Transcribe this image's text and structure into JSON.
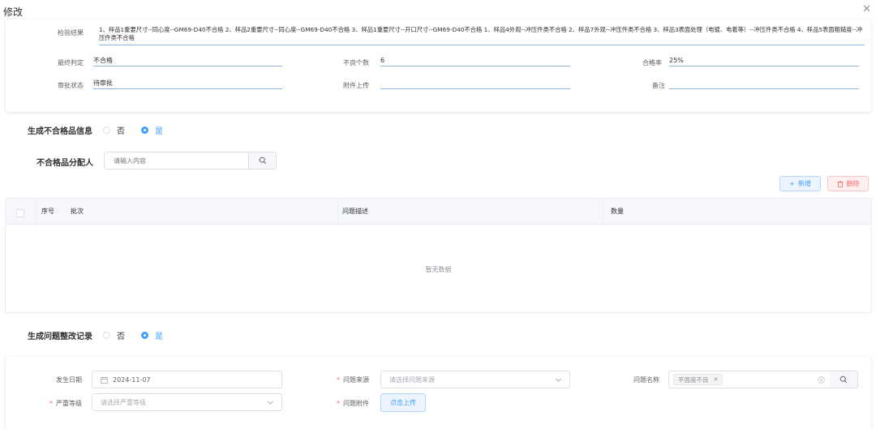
{
  "dialog": {
    "title": "修改"
  },
  "info": {
    "result_label": "检验结果",
    "result_text": "1、样品1重要尺寸--同心度--GM69-D40不合格 2、样品2重要尺寸--同心度--GM69-D40不合格 3、样品1重要尺寸--开口尺寸--GM69-D40不合格 1、样品4外观--冲压件类不合格 2、样品7外观--冲压件类不合格 3、样品3表面处理（电镀、电着等）--冲压件类不合格 4、样品5表面粗糙度--冲压件类不合格",
    "final_label": "最终判定",
    "final_value": "不合格",
    "defect_count_label": "不良个数",
    "defect_count_value": "6",
    "pass_rate_label": "合格率",
    "pass_rate_value": "25%",
    "approval_label": "审批状态",
    "approval_value": "待审批",
    "attach_label": "附件上传",
    "attach_value": "",
    "remark_label": "备注",
    "remark_value": ""
  },
  "nonconform": {
    "label": "生成不合格品信息",
    "opt_no": "否",
    "opt_yes": "是",
    "selected": "是",
    "assignee_label": "不合格品分配人",
    "assignee_placeholder": "请输入内容"
  },
  "toolbar": {
    "add_label": "新增",
    "delete_label": "删除"
  },
  "table": {
    "columns": [
      "序号",
      "批次",
      "问题描述",
      "数量"
    ],
    "rows": [],
    "empty_text": "暂无数据"
  },
  "rectify": {
    "label": "生成问题整改记录",
    "opt_no": "否",
    "opt_yes": "是",
    "selected": "是"
  },
  "form": {
    "date_label": "发生日期",
    "date_value": "2024-11-07",
    "source_label": "问题来源",
    "source_placeholder": "请选择问题来源",
    "name_label": "问题名称",
    "name_tag": "平面度不良",
    "severity_label": "严重等级",
    "severity_placeholder": "请选择严重等级",
    "attachment_label": "问题附件",
    "upload_label": "点击上传"
  },
  "colors": {
    "primary": "#409eff",
    "danger": "#f56c6c"
  }
}
